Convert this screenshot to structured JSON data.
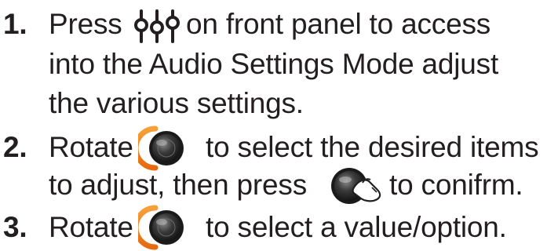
{
  "steps": [
    {
      "number": "1.",
      "lines": [
        {
          "before": "Press",
          "after": "on front panel to access"
        },
        {
          "text": "into the Audio Settings Mode adjust"
        },
        {
          "text": "the various settings."
        }
      ],
      "icon": "audio-settings-button-icon"
    },
    {
      "number": "2.",
      "lines": [
        {
          "before": "Rotate",
          "after": "to select the desired items"
        },
        {
          "before": "to adjust, then press",
          "after": "to conifrm."
        }
      ],
      "icons": [
        "rotary-knob-icon",
        "knob-press-icon"
      ]
    },
    {
      "number": "3.",
      "lines": [
        {
          "before": "Rotate",
          "after": "to select a value/option."
        }
      ],
      "icon": "rotary-knob-icon"
    }
  ],
  "colors": {
    "text": "#231f20",
    "knob_ring": "#f58220",
    "knob_body": "#2b2b2b"
  }
}
